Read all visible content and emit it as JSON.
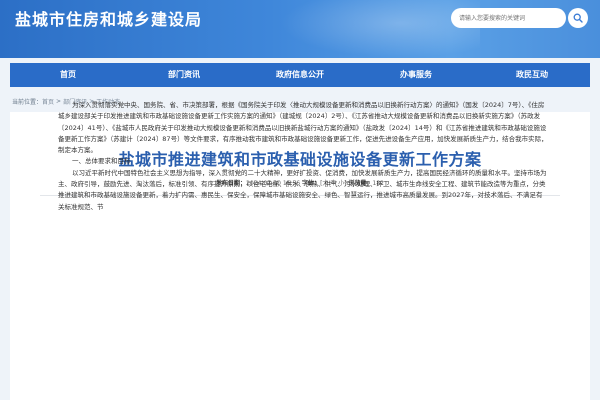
{
  "header": {
    "site_title": "盐城市住房和城乡建设局",
    "search_placeholder": "请输入您要搜索的关键词",
    "search_icon": "search-icon"
  },
  "nav": {
    "items": [
      "首页",
      "部门资讯",
      "政府信息公开",
      "办事服务",
      "政民互动"
    ]
  },
  "breadcrumb": {
    "current_label": "当前位置：",
    "items": [
      "首页",
      "部门资讯",
      "工作动态"
    ],
    "separator": ">"
  },
  "article": {
    "title": "盐城市推进建筑和市政基础设施设备更新工作方案",
    "meta": {
      "published_label": "发布日期：",
      "published_value": "2024-07-30 16:56",
      "font_label": "字体：",
      "font_sizes": "[大 中 小]",
      "views_label": "浏览量：",
      "views_value": "182"
    },
    "paragraphs": [
      "为深入贯彻落实党中央、国务院、省、市决策部署，根据《国务院关于印发〈推动大规模设备更新和消费品以旧换新行动方案〉的通知》（国发〔2024〕7号）、《住房城乡建设部关于印发推进建筑和市政基础设施设备更新工作实施方案的通知》（建城规〔2024〕2号）、《江苏省推动大规模设备更新和消费品以旧换新实施方案》（苏政发〔2024〕41号）、《盐城市人民政府关于印发推动大规模设备更新和消费品以旧换新盐城行动方案的通知》（盐政发〔2024〕14号）和《江苏省推进建筑和市政基础设施设备更新工作方案》（苏建计〔2024〕87号）等文件要求，有序推动我市建筑和市政基础设施设备更新工作，促进先进设备生产应用，加快发展新质生产力，结合我市实际，制定本方案。",
      "一、总体要求和目标",
      "以习近平新时代中国特色社会主义思想为指导，深入贯彻党的二十大精神，更好扩投资、促消费，加快发展新质生产力，提高国民经济循环的质量和水平。坚持市场为主、政府引导，鼓励先进、淘汰落后，标准引领、有序提升原则，以住宅电梯、供水、供热、供气、污水处理、环卫、城市生命线安全工程、建筑节能改造等为重点，分类推进建筑和市政基础设施设备更新，着力扩内需、惠民生、保安全，保障城市基础设施安全、绿色、智慧运行，推进城市高质量发展。到2027年，对技术落后、不满足有关标准规范、节"
    ]
  }
}
